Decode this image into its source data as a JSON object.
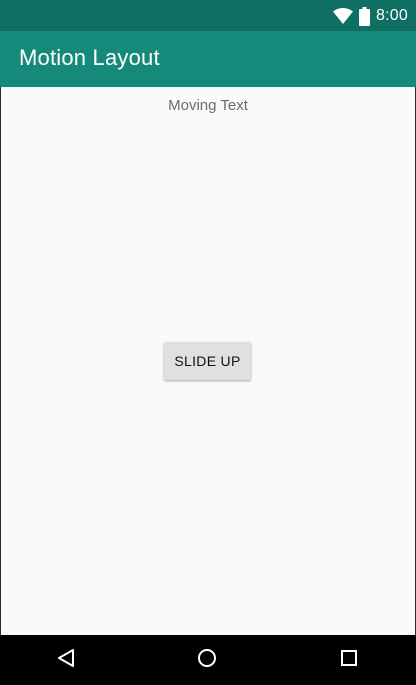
{
  "status_bar": {
    "time": "8:00",
    "wifi_icon": "wifi-icon",
    "battery_icon": "battery-icon",
    "background": "#0f6f63"
  },
  "app_bar": {
    "title": "Motion Layout",
    "background": "#15897a"
  },
  "content": {
    "moving_text": "Moving Text",
    "slide_button_label": "SLIDE UP"
  },
  "nav_bar": {
    "back_icon": "back-icon",
    "home_icon": "home-icon",
    "recents_icon": "recents-icon"
  }
}
